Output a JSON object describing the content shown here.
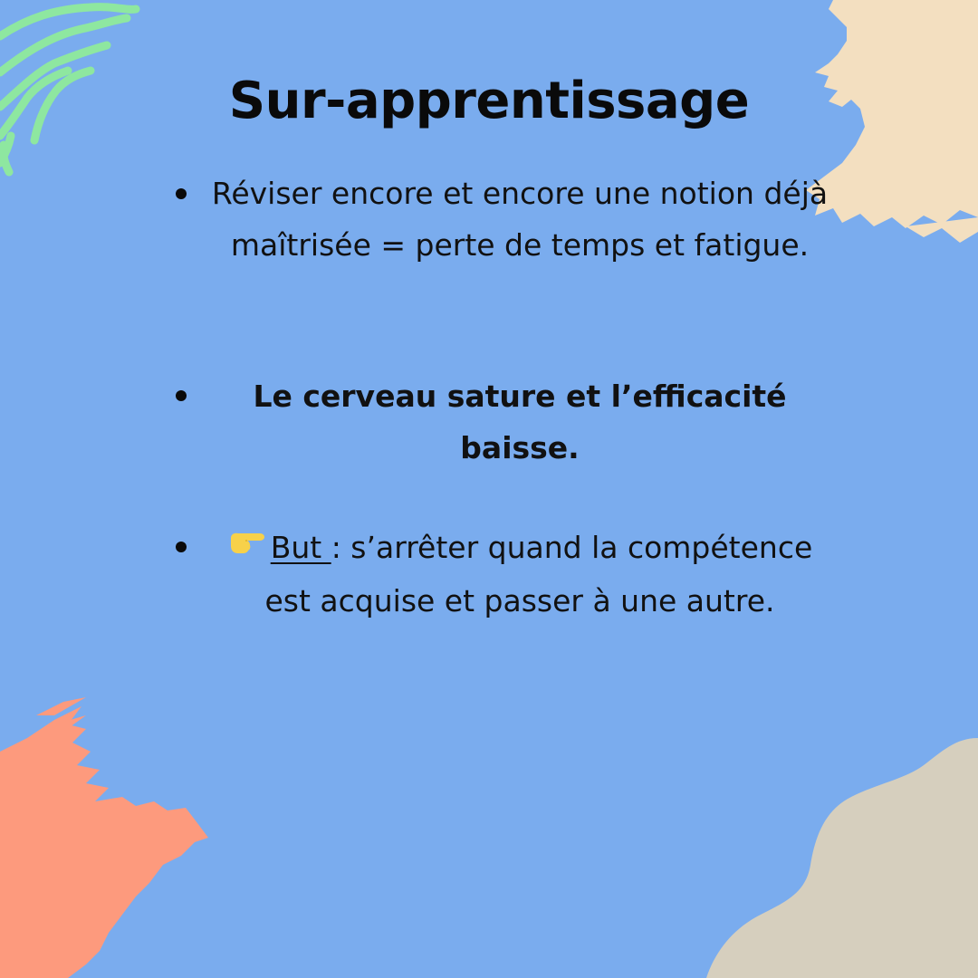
{
  "title": "Sur-apprentissage",
  "colors": {
    "background": "#7aacee",
    "green_stroke": "#8ee7a0",
    "beige_brush": "#f3dfc0",
    "salmon_brush": "#fd9a7d",
    "tan_blob": "#d6cfbe",
    "pointer_emoji": "#f7d14a"
  },
  "items": [
    {
      "text": "Réviser encore et encore une notion déjà maîtrisée = perte de temps et fatigue."
    },
    {
      "text": "Le cerveau sature et l’efficacité baisse."
    },
    {
      "icon": "pointing-hand-icon",
      "underlined": "But ",
      "rest": ": s’arrêter quand la compétence est acquise et passer à une autre."
    }
  ]
}
